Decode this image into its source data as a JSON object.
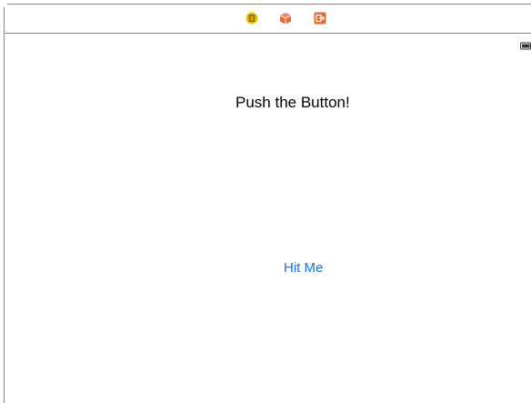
{
  "scene_dock": {
    "icons": [
      "view-controller-icon",
      "first-responder-icon",
      "exit-icon"
    ],
    "colors": {
      "view_controller": "#f2c500",
      "first_responder": "#e8663a",
      "exit": "#e06a2c"
    }
  },
  "status_bar": {
    "battery_icon": "battery-icon"
  },
  "view": {
    "label_text": "Push the Button!",
    "button_title": "Hit Me",
    "button_color": "#1a6fdc"
  }
}
